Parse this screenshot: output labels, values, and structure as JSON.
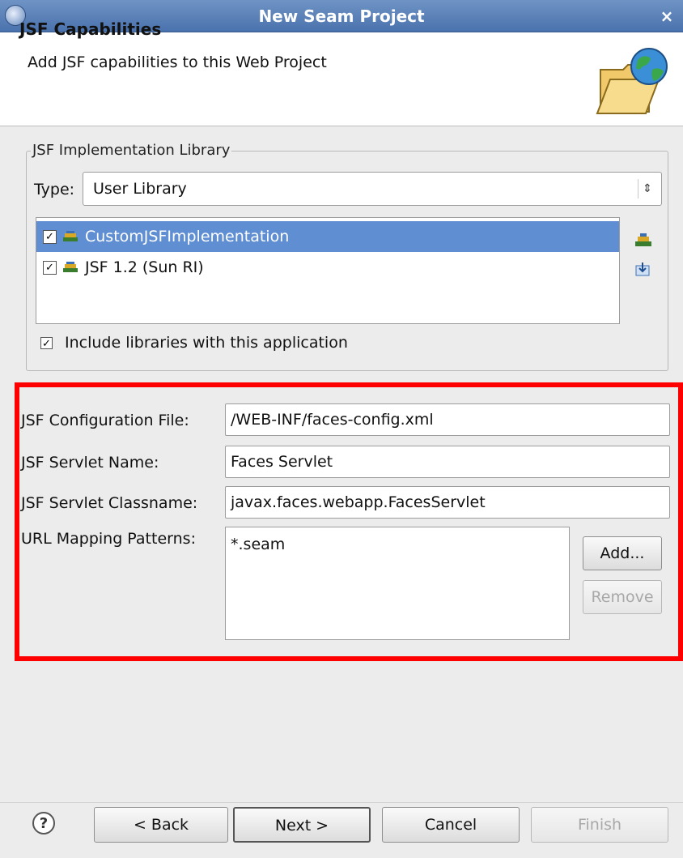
{
  "window": {
    "title": "New Seam Project",
    "close_glyph": "×"
  },
  "header": {
    "title": "JSF Capabilities",
    "description": "Add JSF capabilities to this Web Project",
    "icon": "folder-globe-icon"
  },
  "implementation_library": {
    "legend": "JSF Implementation Library",
    "type_label": "Type:",
    "type_value": "User Library",
    "libraries": [
      {
        "label": "CustomJSFImplementation",
        "checked": true,
        "selected": true
      },
      {
        "label": "JSF 1.2 (Sun RI)",
        "checked": true,
        "selected": false
      }
    ],
    "include_label": "Include libraries with this application",
    "include_checked": true
  },
  "config": {
    "config_file_label": "JSF Configuration File:",
    "config_file_value": "/WEB-INF/faces-config.xml",
    "servlet_name_label": "JSF Servlet Name:",
    "servlet_name_value": "Faces Servlet",
    "servlet_classname_label": "JSF Servlet Classname:",
    "servlet_classname_value": "javax.faces.webapp.FacesServlet",
    "url_mapping_label": "URL Mapping Patterns:",
    "url_patterns": [
      "*.seam"
    ],
    "add_label": "Add...",
    "remove_label": "Remove"
  },
  "footer": {
    "back_label": "< Back",
    "next_label": "Next >",
    "cancel_label": "Cancel",
    "finish_label": "Finish"
  },
  "colors": {
    "highlight": "#ff0000",
    "selection": "#5f8ed2",
    "titlebar": "#4a72ad"
  }
}
